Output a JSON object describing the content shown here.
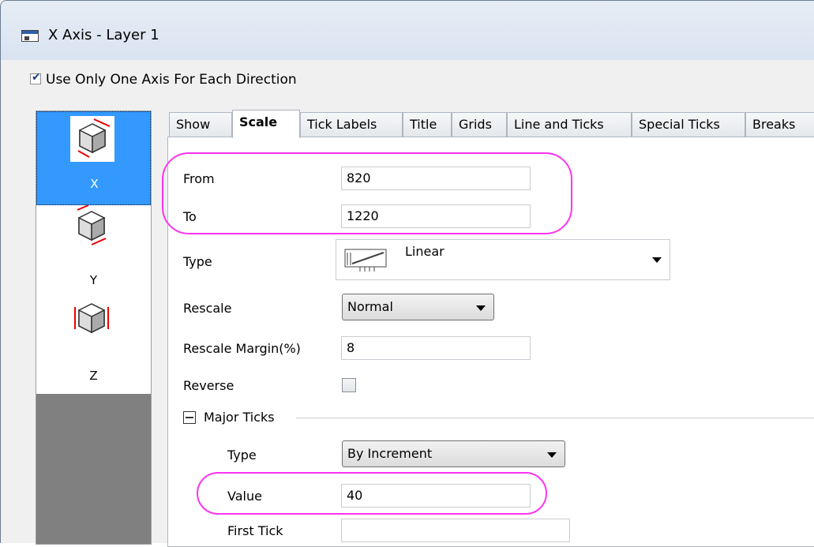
{
  "window": {
    "title": "X Axis - Layer 1"
  },
  "options": {
    "use_one_axis_label": "Use Only One Axis For Each Direction",
    "use_one_axis_checked": true
  },
  "axis_list": [
    {
      "label": "X",
      "selected": true
    },
    {
      "label": "Y",
      "selected": false
    },
    {
      "label": "Z",
      "selected": false
    }
  ],
  "tabs": [
    "Show",
    "Scale",
    "Tick Labels",
    "Title",
    "Grids",
    "Line and Ticks",
    "Special Ticks",
    "Breaks"
  ],
  "active_tab": "Scale",
  "scale": {
    "from_label": "From",
    "from_value": "820",
    "to_label": "To",
    "to_value": "1220",
    "type_label": "Type",
    "type_value": "Linear",
    "rescale_label": "Rescale",
    "rescale_value": "Normal",
    "rescale_margin_label": "Rescale Margin(%)",
    "rescale_margin_value": "8",
    "reverse_label": "Reverse",
    "reverse_checked": false
  },
  "major_ticks": {
    "group_label": "Major Ticks",
    "type_label": "Type",
    "type_value": "By Increment",
    "value_label": "Value",
    "value_value": "40",
    "first_tick_label": "First Tick",
    "first_tick_value": ""
  },
  "colors": {
    "highlight": "#ff33ee",
    "selection": "#3399ff"
  }
}
